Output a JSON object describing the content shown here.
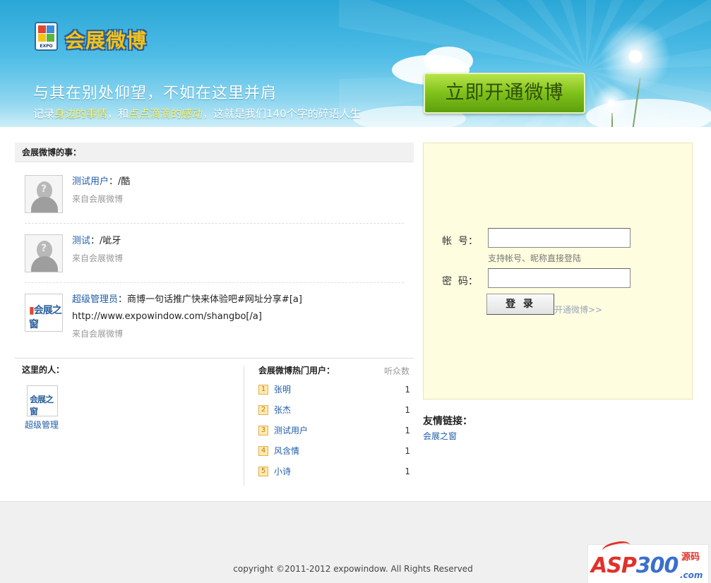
{
  "banner": {
    "logo_text": "会展微博",
    "logo_badge": "EXPO",
    "slogan_main": "与其在别处仰望，不如在这里并肩",
    "slogan_sub_1": "记录",
    "slogan_sub_hl1": "身边的事情",
    "slogan_sub_2": "，和",
    "slogan_sub_hl2": "点点滴滴的感动",
    "slogan_sub_3": "，这就是我们140个字的碎语人生",
    "open_button": "立即开通微博"
  },
  "feed": {
    "title": "会展微博的事：",
    "posts": [
      {
        "user": "测试用户",
        "sep": "：",
        "content": "/酷",
        "source": "来自会展微博"
      },
      {
        "user": "测试",
        "sep": "：",
        "content": "/呲牙",
        "source": "来自会展微博"
      },
      {
        "user": "超级管理员",
        "sep": "：",
        "content": "商博一句话推广快来体验吧#网址分享#[a] http://www.expowindow.com/shangbo[/a]",
        "source": "来自会展微博"
      }
    ]
  },
  "people": {
    "title": "这里的人：",
    "items": [
      {
        "name": "超级管理",
        "logo": "会展之窗"
      }
    ]
  },
  "hot_users": {
    "title": "会展微博热门用户：",
    "fans_header": "听众数",
    "items": [
      {
        "rank": "1",
        "name": "张明",
        "count": "1"
      },
      {
        "rank": "2",
        "name": "张杰",
        "count": "1"
      },
      {
        "rank": "3",
        "name": "测试用户",
        "count": "1"
      },
      {
        "rank": "4",
        "name": "风含情",
        "count": "1"
      },
      {
        "rank": "5",
        "name": "小诗",
        "count": "1"
      }
    ]
  },
  "login": {
    "account_label": "帐  号：",
    "account_value": "",
    "account_hint": "支持帐号、昵称直接登陆",
    "password_label": "密  码：",
    "password_value": "",
    "submit": "登 录",
    "register_link": "开通微博>>"
  },
  "links": {
    "title": "友情链接：",
    "items": [
      "会展之窗"
    ]
  },
  "footer": {
    "copyright": "copyright ©2011-2012 expowindow. All Rights Reserved",
    "watermark_main_a": "ASP",
    "watermark_main_b": "300",
    "watermark_side": "源码",
    "watermark_com": ".com"
  },
  "colors": {
    "link": "#1f5da8",
    "button_green": "#7fc11a",
    "login_bg": "#fffde0",
    "highlight_yellow": "#fff36a"
  }
}
